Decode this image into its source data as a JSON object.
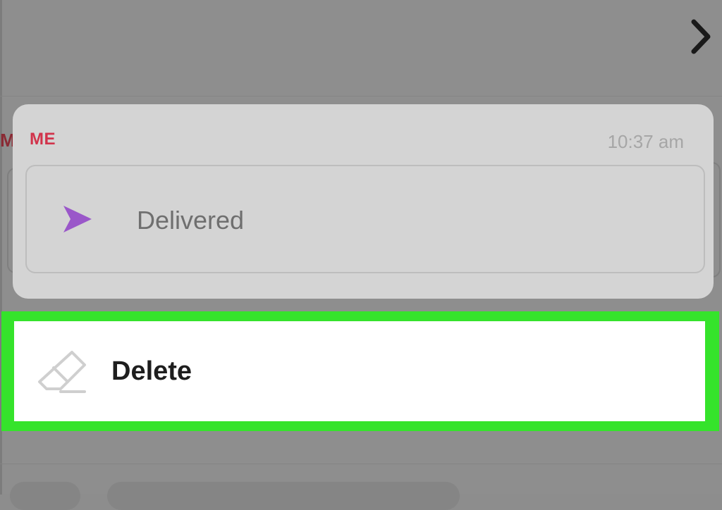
{
  "background": {
    "peek_letter": "M"
  },
  "message": {
    "sender": "ME",
    "time": "10:37 am",
    "status_label": "Delivered",
    "status_icon": "sent-arrow-icon"
  },
  "action": {
    "delete_label": "Delete",
    "delete_icon": "eraser-icon"
  },
  "colors": {
    "sender": "#d1334b",
    "status_icon": "#9a57c9",
    "highlight": "#35e32b"
  }
}
